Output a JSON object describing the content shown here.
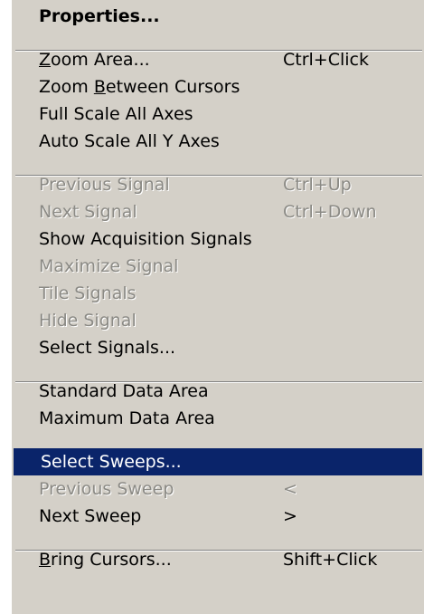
{
  "menu": {
    "groups": [
      [
        {
          "label": "Properties...",
          "bold": true
        }
      ],
      [
        {
          "label": "Zoom Area...",
          "mnemonic": "Z",
          "shortcut": "Ctrl+Click"
        },
        {
          "label": "Zoom Between Cursors",
          "mnemonic": "B"
        },
        {
          "label": "Full Scale All Axes"
        },
        {
          "label": "Auto Scale All Y Axes"
        }
      ],
      [
        {
          "label": "Previous Signal",
          "shortcut": "Ctrl+Up",
          "disabled": true
        },
        {
          "label": "Next Signal",
          "shortcut": "Ctrl+Down",
          "disabled": true
        },
        {
          "label": "Show Acquisition Signals"
        },
        {
          "label": "Maximize Signal",
          "disabled": true
        },
        {
          "label": "Tile Signals",
          "disabled": true
        },
        {
          "label": "Hide Signal",
          "disabled": true
        },
        {
          "label": "Select Signals..."
        }
      ],
      [
        {
          "label": "Standard Data Area"
        },
        {
          "label": "Maximum Data Area"
        }
      ],
      [
        {
          "label": "Select Sweeps...",
          "highlighted": true
        },
        {
          "label": "Previous Sweep",
          "shortcut": "<",
          "disabled": true
        },
        {
          "label": "Next Sweep",
          "shortcut": ">"
        }
      ],
      [
        {
          "label": "Bring Cursors...",
          "mnemonic": "B",
          "shortcut": "Shift+Click"
        }
      ]
    ]
  },
  "colors": {
    "menu_bg": "#d4d0c8",
    "highlight_bg": "#0a246a",
    "highlight_text": "#ffffff",
    "disabled_text": "#8b8a85"
  }
}
